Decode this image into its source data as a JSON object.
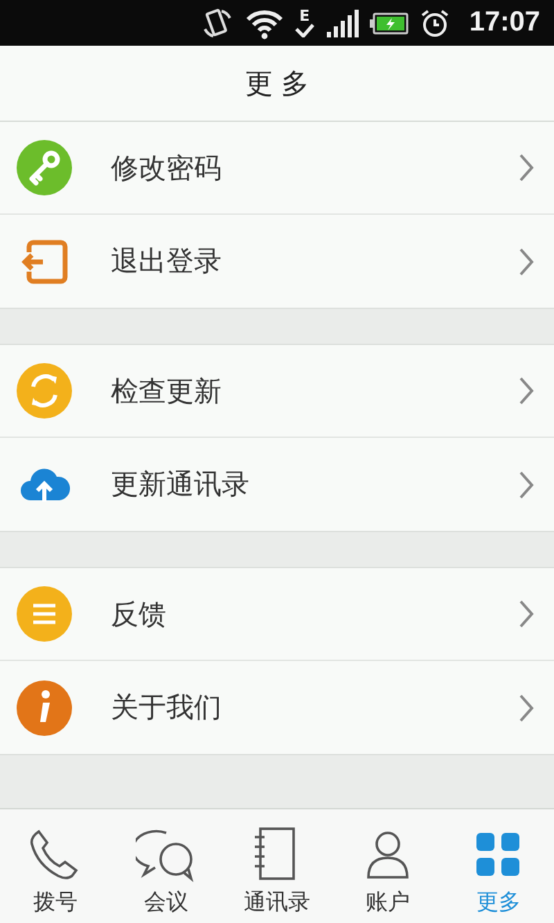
{
  "status_bar": {
    "network": "E",
    "time": "17:07"
  },
  "header": {
    "title": "更 多"
  },
  "sections": [
    {
      "items": [
        {
          "label": "修改密码"
        },
        {
          "label": "退出登录"
        }
      ]
    },
    {
      "items": [
        {
          "label": "检查更新"
        },
        {
          "label": "更新通讯录"
        }
      ]
    },
    {
      "items": [
        {
          "label": "反馈"
        },
        {
          "label": "关于我们"
        }
      ]
    }
  ],
  "tabs": [
    {
      "label": "拨号",
      "selected": false
    },
    {
      "label": "会议",
      "selected": false
    },
    {
      "label": "通讯录",
      "selected": false
    },
    {
      "label": "账户",
      "selected": false
    },
    {
      "label": "更多",
      "selected": true
    }
  ]
}
